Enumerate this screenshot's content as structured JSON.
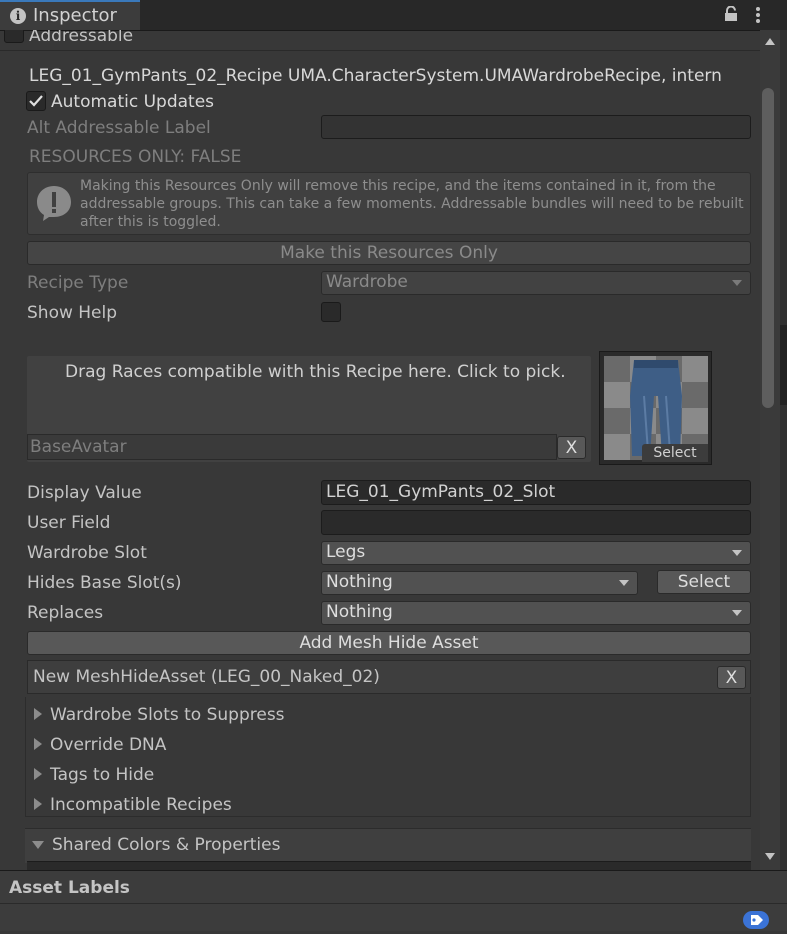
{
  "tab": {
    "title": "Inspector"
  },
  "addressable": {
    "label": "Addressable"
  },
  "recipe": {
    "header": "LEG_01_GymPants_02_Recipe UMA.CharacterSystem.UMAWardrobeRecipe, intern",
    "automatic_updates_label": "Automatic Updates",
    "automatic_updates_checked": true,
    "alt_label": "Alt Addressable Label",
    "alt_value": "",
    "resources_only": "RESOURCES ONLY: FALSE",
    "warning": "Making this Resources Only will remove this recipe, and the items contained in it, from the addressable groups. This can take a few moments. Addressable bundles will need to be rebuilt after this is toggled.",
    "make_resources_button": "Make this Resources Only",
    "recipe_type_label": "Recipe Type",
    "recipe_type_value": "Wardrobe",
    "show_help_label": "Show Help"
  },
  "races": {
    "drop_text": "Drag Races compatible with this Recipe here. Click to pick.",
    "item": "BaseAvatar",
    "remove": "X",
    "thumb_select": "Select"
  },
  "fields": {
    "display_value_label": "Display Value",
    "display_value": "LEG_01_GymPants_02_Slot",
    "user_field_label": "User Field",
    "user_field": "",
    "wardrobe_slot_label": "Wardrobe Slot",
    "wardrobe_slot": "Legs",
    "hides_label": "Hides Base Slot(s)",
    "hides_value": "Nothing",
    "hides_select": "Select",
    "replaces_label": "Replaces",
    "replaces_value": "Nothing"
  },
  "mesh_hide": {
    "add_button": "Add Mesh Hide Asset",
    "item": "New MeshHideAsset (LEG_00_Naked_02)",
    "remove": "X"
  },
  "foldouts": [
    "Wardrobe Slots to Suppress",
    "Override DNA",
    "Tags to Hide",
    "Incompatible Recipes"
  ],
  "shared_colors": "Shared Colors & Properties",
  "asset_labels": "Asset Labels",
  "icons": [
    "info-icon",
    "lock-icon",
    "kebab-menu-icon",
    "warning-icon",
    "tag-icon"
  ],
  "colors": {
    "accent": "#3a79bb",
    "tag": "#3b73d6"
  }
}
